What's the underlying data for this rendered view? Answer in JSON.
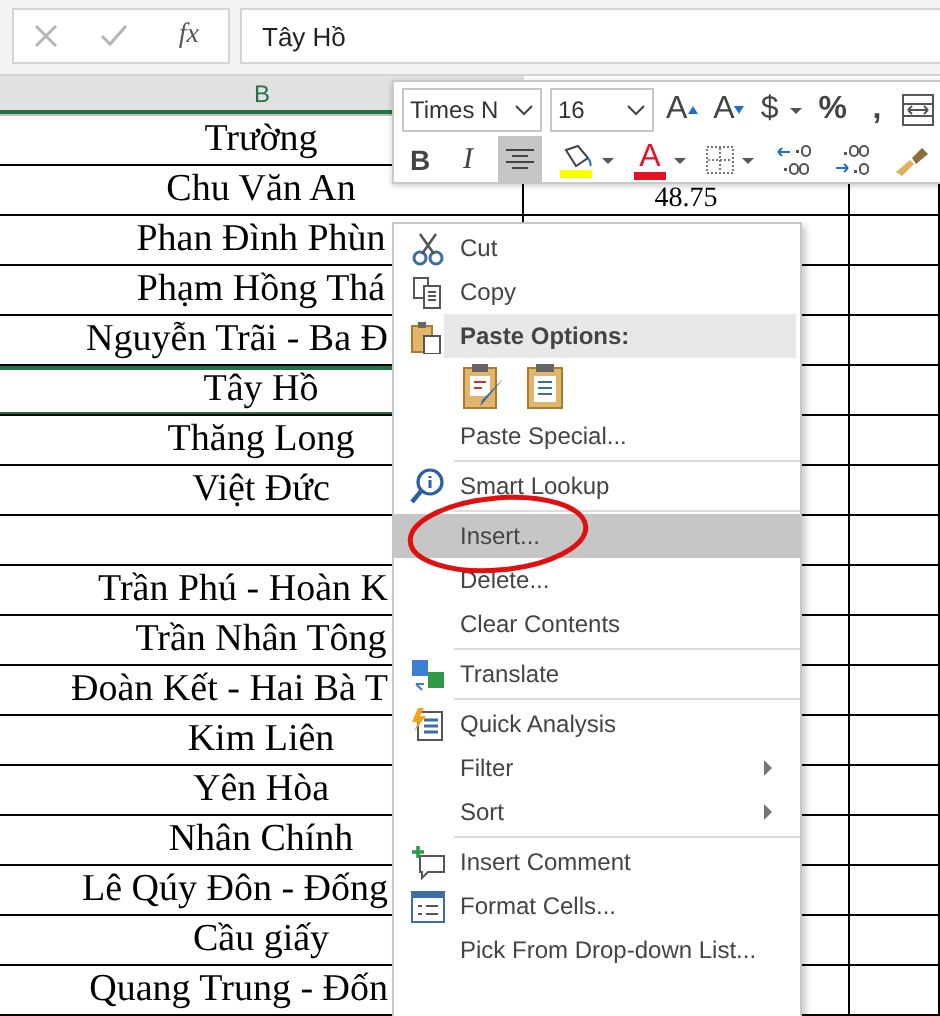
{
  "formula_bar": {
    "function_label": "fx",
    "value": "Tây Hồ"
  },
  "sheet": {
    "column_header": "B",
    "rows": [
      {
        "b": "Trường",
        "c": "",
        "selected": false
      },
      {
        "b": "Chu Văn An",
        "c": "48.75",
        "selected": false
      },
      {
        "b": "Phan Đình Phùn",
        "c": "",
        "selected": false
      },
      {
        "b": "Phạm Hồng Thá",
        "c": "",
        "selected": false
      },
      {
        "b": "Nguyễn Trãi - Ba Đ",
        "c": "",
        "selected": false
      },
      {
        "b": "Tây Hồ",
        "c": "",
        "selected": true
      },
      {
        "b": "Thăng Long",
        "c": "",
        "selected": false
      },
      {
        "b": "Việt Đức",
        "c": "",
        "selected": false
      },
      {
        "b": "",
        "c": "",
        "selected": false
      },
      {
        "b": "Trần Phú - Hoàn K",
        "c": "",
        "selected": false
      },
      {
        "b": "Trần Nhân Tông",
        "c": "",
        "selected": false
      },
      {
        "b": "Đoàn Kết - Hai Bà T",
        "c": "",
        "selected": false
      },
      {
        "b": "Kim Liên",
        "c": "",
        "selected": false
      },
      {
        "b": "Yên Hòa",
        "c": "",
        "selected": false
      },
      {
        "b": "Nhân Chính",
        "c": "",
        "selected": false
      },
      {
        "b": "Lê Qúy Đôn - Đống",
        "c": "",
        "selected": false
      },
      {
        "b": "Cầu giấy",
        "c": "",
        "selected": false
      },
      {
        "b": "Quang Trung - Đốn",
        "c": "",
        "selected": false
      }
    ]
  },
  "mini_toolbar": {
    "font": "Times N",
    "size": "16",
    "row_1": [
      {
        "kind": "grow_font",
        "label": "A"
      },
      {
        "kind": "shrink_font",
        "label": "A"
      },
      {
        "kind": "currency",
        "label": "$"
      },
      {
        "kind": "percent",
        "label": "%"
      },
      {
        "kind": "comma",
        "label": ","
      },
      {
        "kind": "table"
      }
    ],
    "row_2": [
      {
        "kind": "bold",
        "label": "B",
        "selected": false
      },
      {
        "kind": "italic",
        "label": "I",
        "selected": false
      },
      {
        "kind": "center",
        "selected": true
      },
      {
        "kind": "fill_color",
        "color": "#ffff00",
        "selected": false
      },
      {
        "kind": "font_color",
        "label": "A",
        "color": "#e81123",
        "selected": false
      },
      {
        "kind": "borders",
        "selected": false
      },
      {
        "kind": "increase_decimal",
        "selected": false
      },
      {
        "kind": "decrease_decimal",
        "selected": false
      },
      {
        "kind": "format_painter",
        "selected": false
      }
    ]
  },
  "context_menu": {
    "items": [
      {
        "kind": "item",
        "label": "Cut",
        "highlighted": false,
        "submenu": false
      },
      {
        "kind": "item",
        "label": "Copy",
        "highlighted": false,
        "submenu": false
      },
      {
        "kind": "header",
        "label": "Paste Options:"
      },
      {
        "kind": "paste_icons"
      },
      {
        "kind": "item",
        "label": "Paste Special...",
        "highlighted": false,
        "submenu": false
      },
      {
        "kind": "separator"
      },
      {
        "kind": "item",
        "label": "Smart Lookup",
        "highlighted": false,
        "submenu": false
      },
      {
        "kind": "separator"
      },
      {
        "kind": "item",
        "label": "Insert...",
        "highlighted": true,
        "submenu": false
      },
      {
        "kind": "item",
        "label": "Delete...",
        "highlighted": false,
        "submenu": false
      },
      {
        "kind": "item",
        "label": "Clear Contents",
        "highlighted": false,
        "submenu": false
      },
      {
        "kind": "separator"
      },
      {
        "kind": "item",
        "label": "Translate",
        "highlighted": false,
        "submenu": false
      },
      {
        "kind": "separator"
      },
      {
        "kind": "item",
        "label": "Quick Analysis",
        "highlighted": false,
        "submenu": false
      },
      {
        "kind": "item",
        "label": "Filter",
        "highlighted": false,
        "submenu": true
      },
      {
        "kind": "item",
        "label": "Sort",
        "highlighted": false,
        "submenu": true
      },
      {
        "kind": "separator"
      },
      {
        "kind": "item",
        "label": "Insert Comment",
        "highlighted": false,
        "submenu": false
      },
      {
        "kind": "item",
        "label": "Format Cells...",
        "highlighted": false,
        "submenu": false
      },
      {
        "kind": "item",
        "label": "Pick From Drop-down List...",
        "highlighted": false,
        "submenu": false
      }
    ]
  },
  "annotation": {
    "kind": "ellipse"
  }
}
